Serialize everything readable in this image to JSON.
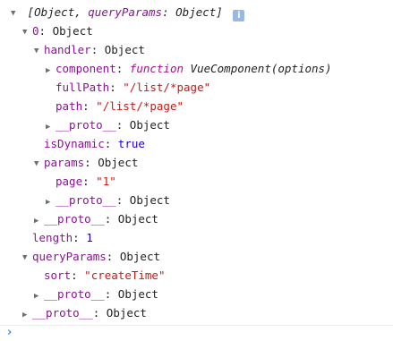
{
  "summary": {
    "open": "[",
    "text1": "Object, ",
    "key": "queryParams",
    "sep": ": ",
    "text2": "Object",
    "close": "]",
    "info_icon": "i"
  },
  "rows": {
    "r0": {
      "key": "0",
      "sep": ": ",
      "val": "Object"
    },
    "handler": {
      "key": "handler",
      "sep": ": ",
      "val": "Object"
    },
    "component": {
      "key": "component",
      "sep": ": ",
      "fnkw": "function",
      "fnsig": "VueComponent(options)"
    },
    "fullPath": {
      "key": "fullPath",
      "sep": ": ",
      "val": "\"/list/*page\""
    },
    "path": {
      "key": "path",
      "sep": ": ",
      "val": "\"/list/*page\""
    },
    "proto1": {
      "key": "__proto__",
      "sep": ": ",
      "val": "Object"
    },
    "isDynamic": {
      "key": "isDynamic",
      "sep": ": ",
      "val": "true"
    },
    "params": {
      "key": "params",
      "sep": ": ",
      "val": "Object"
    },
    "page": {
      "key": "page",
      "sep": ": ",
      "val": "\"1\""
    },
    "proto2": {
      "key": "__proto__",
      "sep": ": ",
      "val": "Object"
    },
    "proto3": {
      "key": "__proto__",
      "sep": ": ",
      "val": "Object"
    },
    "length": {
      "key": "length",
      "sep": ": ",
      "val": "1"
    },
    "queryParams": {
      "key": "queryParams",
      "sep": ": ",
      "val": "Object"
    },
    "sort": {
      "key": "sort",
      "sep": ": ",
      "val": "\"createTime\""
    },
    "proto4": {
      "key": "__proto__",
      "sep": ": ",
      "val": "Object"
    },
    "proto5": {
      "key": "__proto__",
      "sep": ": ",
      "val": "Object"
    }
  },
  "console": {
    "prompt_icon": "›"
  },
  "colors": {
    "key_purple": "#881391",
    "string_red": "#c41a16",
    "keyword_blue": "#1c00cf",
    "prompt_blue": "#3d8fe8"
  }
}
